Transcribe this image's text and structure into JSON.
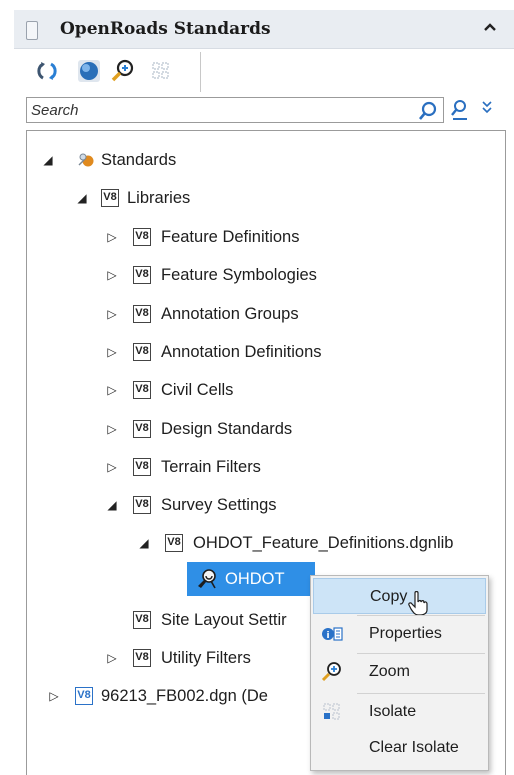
{
  "panel": {
    "title": "OpenRoads Standards",
    "collapse_glyph": "⌃"
  },
  "toolbar": {
    "buttons": [
      "refresh-icon",
      "globe-icon",
      "zoom-in-icon",
      "isolate-grid-icon"
    ]
  },
  "search": {
    "placeholder": "Search",
    "search_icon": "magnifier-icon",
    "filter_icon": "user-filter-icon",
    "expand_glyph": "≫"
  },
  "tree": {
    "root": {
      "label": "Standards",
      "expanded": true
    },
    "libraries": {
      "label": "Libraries",
      "expanded": true
    },
    "library_items": [
      {
        "label": "Feature Definitions",
        "expanded": false
      },
      {
        "label": "Feature Symbologies",
        "expanded": false
      },
      {
        "label": "Annotation Groups",
        "expanded": false
      },
      {
        "label": "Annotation Definitions",
        "expanded": false
      },
      {
        "label": "Civil Cells",
        "expanded": false
      },
      {
        "label": "Design Standards",
        "expanded": false
      },
      {
        "label": "Terrain Filters",
        "expanded": false
      },
      {
        "label": "Survey Settings",
        "expanded": true
      }
    ],
    "survey_child": {
      "label": "OHDOT_Feature_Definitions.dgnlib",
      "expanded": true
    },
    "selected_item": {
      "label": "OHDOT"
    },
    "after_items": [
      {
        "label": "Site Layout Settir"
      },
      {
        "label": "Utility Filters",
        "expanded": false
      }
    ],
    "file": {
      "label": "96213_FB002.dgn (De",
      "expanded": false
    }
  },
  "context_menu": {
    "items": [
      {
        "label": "Copy",
        "icon": "",
        "hover": true
      },
      {
        "label": "Properties",
        "icon": "properties-icon"
      },
      {
        "label": "Zoom",
        "icon": "zoom-icon"
      },
      {
        "label": "Isolate",
        "icon": "isolate-icon"
      },
      {
        "label": "Clear Isolate",
        "icon": ""
      }
    ]
  },
  "colors": {
    "selection": "#2f8fe6",
    "menu_hover": "#cde4f7",
    "v8_blue": "#2b72c8"
  }
}
